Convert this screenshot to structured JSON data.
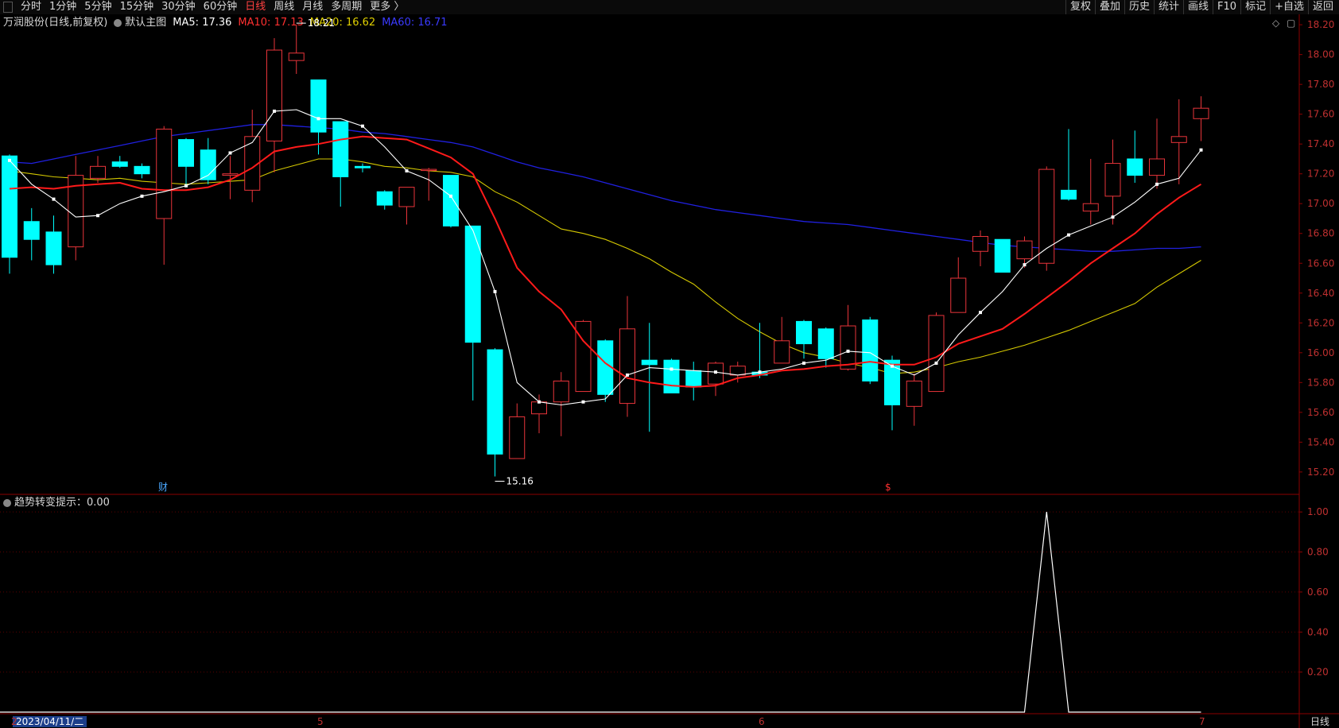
{
  "toolbar": {
    "periods": [
      "分时",
      "1分钟",
      "5分钟",
      "15分钟",
      "30分钟",
      "60分钟",
      "日线",
      "周线",
      "月线",
      "多周期",
      "更多 〉"
    ],
    "active_period": "日线",
    "tools": [
      "复权",
      "叠加",
      "历史",
      "统计",
      "画线",
      "F10",
      "标记",
      "+自选",
      "返回"
    ]
  },
  "legend": {
    "title": "万润股份(日线,前复权)",
    "template": "默认主图",
    "ma5": "MA5: 17.36",
    "ma10": "MA10: 17.13",
    "ma20": "MA20: 16.62",
    "ma60": "MA60: 16.71"
  },
  "sub_legend": {
    "label": "趋势转变提示：0.00"
  },
  "bottom": {
    "date_label": "2023/04/11/二",
    "view_label": "日线"
  },
  "x_ticks": [
    "2",
    "5",
    "6",
    "7"
  ],
  "markers": {
    "fin": "财",
    "s": "$"
  },
  "colors": {
    "up": "#e8343a",
    "down": "#00ffff",
    "ma5": "#ffffff",
    "ma10": "#ff1a1a",
    "ma20": "#d4c800",
    "ma60": "#2020e0",
    "grid": "#8b0000"
  },
  "chart_data": [
    {
      "type": "candlestick",
      "title": "万润股份(日线,前复权)",
      "ylim": [
        15.05,
        18.27
      ],
      "yticks": [
        15.2,
        15.4,
        15.6,
        15.8,
        16.0,
        16.2,
        16.4,
        16.6,
        16.8,
        17.0,
        17.2,
        17.4,
        17.6,
        17.8,
        18.0,
        18.2
      ],
      "ohlc": [
        [
          17.32,
          17.33,
          16.53,
          16.64
        ],
        [
          16.88,
          16.97,
          16.62,
          16.76
        ],
        [
          16.81,
          16.92,
          16.53,
          16.59
        ],
        [
          16.71,
          17.32,
          16.62,
          17.19
        ],
        [
          17.17,
          17.32,
          17.14,
          17.25
        ],
        [
          17.28,
          17.32,
          17.24,
          17.25
        ],
        [
          17.25,
          17.27,
          17.17,
          17.2
        ],
        [
          16.9,
          17.52,
          16.59,
          17.5
        ],
        [
          17.43,
          17.44,
          17.13,
          17.25
        ],
        [
          17.36,
          17.44,
          17.13,
          17.16
        ],
        [
          17.19,
          17.32,
          17.03,
          17.2
        ],
        [
          17.09,
          17.63,
          17.01,
          17.45
        ],
        [
          17.42,
          18.11,
          17.21,
          18.03
        ],
        [
          17.96,
          18.2,
          17.87,
          18.01
        ],
        [
          17.83,
          17.83,
          17.33,
          17.48
        ],
        [
          17.55,
          17.55,
          16.98,
          17.18
        ],
        [
          17.25,
          17.27,
          17.21,
          17.24
        ],
        [
          17.08,
          17.09,
          16.96,
          16.99
        ],
        [
          16.98,
          17.1,
          16.86,
          17.11
        ],
        [
          17.23,
          17.24,
          17.02,
          17.23
        ],
        [
          17.19,
          17.19,
          16.84,
          16.85
        ],
        [
          16.85,
          16.85,
          15.68,
          16.07
        ],
        [
          16.02,
          16.03,
          15.17,
          15.32
        ],
        [
          15.29,
          15.66,
          15.29,
          15.57
        ],
        [
          15.59,
          15.72,
          15.46,
          15.67
        ],
        [
          15.67,
          15.87,
          15.44,
          15.81
        ],
        [
          15.74,
          16.22,
          15.75,
          16.21
        ],
        [
          16.08,
          16.09,
          15.67,
          15.72
        ],
        [
          15.66,
          16.38,
          15.57,
          16.16
        ],
        [
          15.95,
          16.2,
          15.47,
          15.92
        ],
        [
          15.95,
          15.96,
          15.74,
          15.73
        ],
        [
          15.88,
          15.94,
          15.68,
          15.77
        ],
        [
          15.79,
          15.94,
          15.71,
          15.93
        ],
        [
          15.85,
          15.94,
          15.8,
          15.91
        ],
        [
          15.87,
          16.2,
          15.83,
          15.85
        ],
        [
          15.93,
          16.24,
          15.93,
          16.08
        ],
        [
          16.21,
          16.22,
          15.96,
          16.06
        ],
        [
          16.16,
          16.17,
          15.9,
          15.96
        ],
        [
          15.89,
          16.32,
          15.88,
          16.18
        ],
        [
          16.22,
          16.24,
          15.79,
          15.81
        ],
        [
          15.95,
          15.98,
          15.48,
          15.65
        ],
        [
          15.64,
          15.86,
          15.51,
          15.81
        ],
        [
          15.74,
          16.27,
          15.74,
          16.25
        ],
        [
          16.27,
          16.64,
          16.29,
          16.5
        ],
        [
          16.68,
          16.82,
          16.58,
          16.78
        ],
        [
          16.76,
          16.76,
          16.57,
          16.54
        ],
        [
          16.63,
          16.78,
          16.57,
          16.75
        ],
        [
          16.6,
          17.25,
          16.55,
          17.23
        ],
        [
          17.09,
          17.5,
          17.02,
          17.03
        ],
        [
          16.95,
          17.3,
          16.86,
          17.0
        ],
        [
          17.05,
          17.43,
          16.86,
          17.27
        ],
        [
          17.3,
          17.49,
          17.14,
          17.19
        ],
        [
          17.19,
          17.57,
          17.1,
          17.3
        ],
        [
          17.41,
          17.7,
          17.13,
          17.45
        ],
        [
          17.57,
          17.72,
          17.42,
          17.64
        ]
      ],
      "ma5": [
        17.29,
        17.13,
        17.03,
        16.91,
        16.92,
        17.0,
        17.05,
        17.08,
        17.12,
        17.19,
        17.34,
        17.41,
        17.62,
        17.63,
        17.57,
        17.57,
        17.52,
        17.38,
        17.22,
        17.16,
        17.05,
        16.82,
        16.41,
        15.8,
        15.67,
        15.65,
        15.67,
        15.69,
        15.85,
        15.9,
        15.89,
        15.88,
        15.87,
        15.85,
        15.87,
        15.89,
        15.93,
        15.95,
        16.01,
        16.0,
        15.91,
        15.85,
        15.93,
        16.12,
        16.27,
        16.41,
        16.59,
        16.7,
        16.79,
        16.85,
        16.91,
        17.01,
        17.13,
        17.17,
        17.36
      ],
      "ma10": [
        17.1,
        17.11,
        17.1,
        17.12,
        17.13,
        17.14,
        17.1,
        17.09,
        17.09,
        17.11,
        17.16,
        17.24,
        17.35,
        17.38,
        17.4,
        17.43,
        17.45,
        17.44,
        17.43,
        17.37,
        17.31,
        17.2,
        16.9,
        16.57,
        16.41,
        16.29,
        16.08,
        15.93,
        15.83,
        15.8,
        15.78,
        15.77,
        15.78,
        15.83,
        15.85,
        15.88,
        15.89,
        15.91,
        15.92,
        15.94,
        15.92,
        15.92,
        15.97,
        16.06,
        16.11,
        16.16,
        16.26,
        16.37,
        16.48,
        16.6,
        16.7,
        16.8,
        16.93,
        17.04,
        17.13
      ],
      "ma20": [
        17.22,
        17.2,
        17.18,
        17.17,
        17.16,
        17.17,
        17.15,
        17.14,
        17.13,
        17.14,
        17.15,
        17.16,
        17.22,
        17.26,
        17.3,
        17.3,
        17.28,
        17.25,
        17.24,
        17.22,
        17.21,
        17.18,
        17.08,
        17.01,
        16.92,
        16.83,
        16.8,
        16.76,
        16.7,
        16.63,
        16.54,
        16.46,
        16.34,
        16.23,
        16.14,
        16.06,
        16.0,
        15.97,
        15.93,
        15.9,
        15.86,
        15.87,
        15.9,
        15.94,
        15.97,
        16.01,
        16.05,
        16.1,
        16.15,
        16.21,
        16.27,
        16.33,
        16.44,
        16.53,
        16.62
      ],
      "ma60": [
        17.28,
        17.27,
        17.3,
        17.33,
        17.36,
        17.39,
        17.42,
        17.45,
        17.47,
        17.49,
        17.51,
        17.53,
        17.53,
        17.52,
        17.51,
        17.5,
        17.48,
        17.47,
        17.45,
        17.43,
        17.41,
        17.38,
        17.33,
        17.28,
        17.24,
        17.21,
        17.18,
        17.14,
        17.1,
        17.06,
        17.02,
        16.99,
        16.96,
        16.94,
        16.92,
        16.9,
        16.88,
        16.87,
        16.86,
        16.84,
        16.82,
        16.8,
        16.78,
        16.76,
        16.74,
        16.72,
        16.71,
        16.7,
        16.69,
        16.68,
        16.68,
        16.69,
        16.7,
        16.7,
        16.71
      ],
      "high_label": "18.21",
      "low_label": "15.16"
    },
    {
      "type": "line",
      "title": "趋势转变提示",
      "ylim": [
        0,
        1.08
      ],
      "yticks": [
        0.2,
        0.4,
        0.6,
        0.8,
        1.0
      ],
      "values": [
        0,
        0,
        0,
        0,
        0,
        0,
        0,
        0,
        0,
        0,
        0,
        0,
        0,
        0,
        0,
        0,
        0,
        0,
        0,
        0,
        0,
        0,
        0,
        0,
        0,
        0,
        0,
        0,
        0,
        0,
        0,
        0,
        0,
        0,
        0,
        0,
        0,
        0,
        0,
        0,
        0,
        0,
        0,
        0,
        0,
        0,
        0,
        1,
        0,
        0,
        0,
        0,
        0,
        0,
        0
      ]
    }
  ]
}
